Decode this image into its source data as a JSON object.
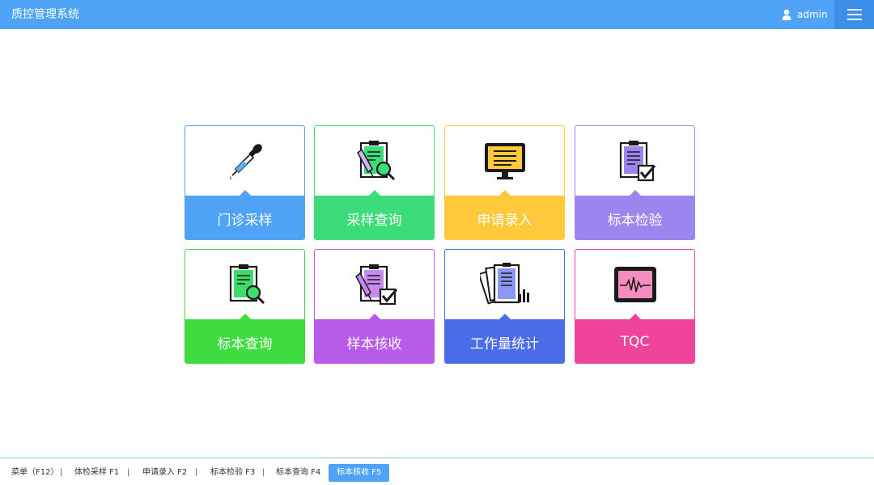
{
  "header": {
    "title": "质控管理系统",
    "user": "admin",
    "user_icon": "user-icon",
    "menu_icon": "hamburger-menu-icon"
  },
  "tiles": [
    {
      "label": "门诊采样",
      "icon": "dropper-icon",
      "color": "#4fa3f7"
    },
    {
      "label": "采样查询",
      "icon": "clipboard-search-icon",
      "color": "#3ddc7a"
    },
    {
      "label": "申请录入",
      "icon": "monitor-document-icon",
      "color": "#ffc93c"
    },
    {
      "label": "标本检验",
      "icon": "clipboard-check-icon",
      "color": "#9b86f0"
    },
    {
      "label": "标本查询",
      "icon": "clipboard-search-icon",
      "color": "#3edc3e"
    },
    {
      "label": "样本核收",
      "icon": "clipboard-check-dropper-icon",
      "color": "#b85be8"
    },
    {
      "label": "工作量统计",
      "icon": "documents-stats-icon",
      "color": "#4a6ce8"
    },
    {
      "label": "TQC",
      "icon": "ecg-monitor-icon",
      "color": "#f0449a"
    }
  ],
  "footer": {
    "items": [
      {
        "label": "菜单（F12）"
      },
      {
        "label": "体检采样  F1"
      },
      {
        "label": "申请录入  F2"
      },
      {
        "label": "标本检验  F3"
      },
      {
        "label": "标本查询  F4"
      },
      {
        "label": "标本核收  F5",
        "active": true
      }
    ],
    "separator": "|"
  }
}
